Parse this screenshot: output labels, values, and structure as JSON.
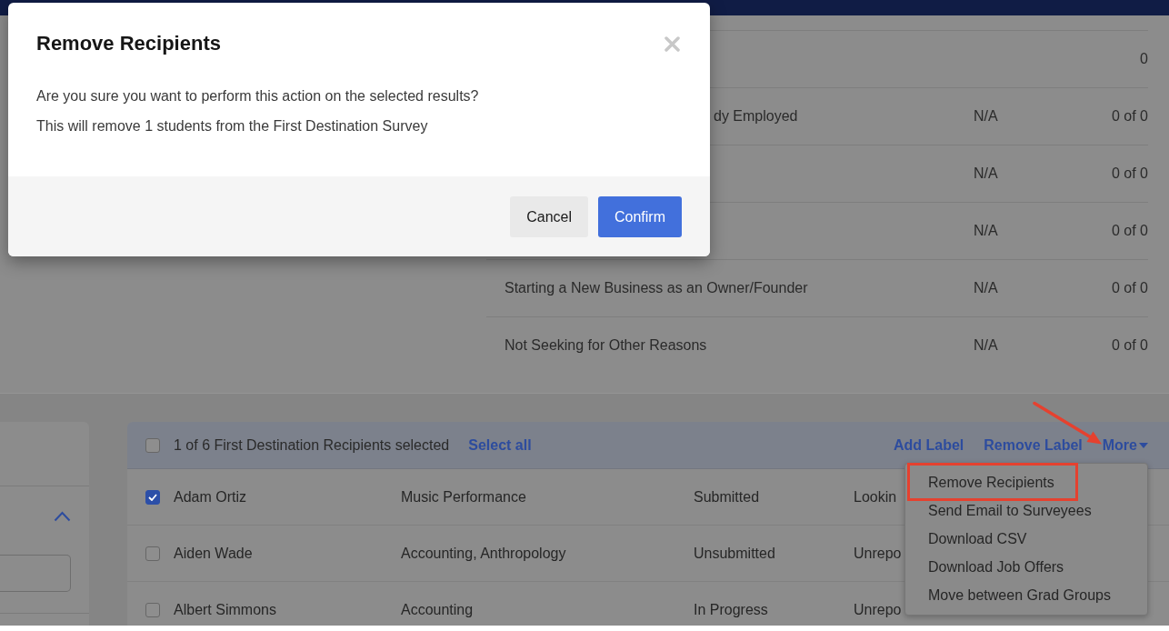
{
  "dialog": {
    "title": "Remove Recipients",
    "message": "Are you sure you want to perform this action on the selected results?",
    "detail": "This will remove 1 students from the First Destination Survey",
    "buttons": [
      {
        "label": "Cancel",
        "kind": "secondary"
      },
      {
        "label": "Confirm",
        "kind": "primary"
      }
    ]
  },
  "summary_table": {
    "rows": [
      {
        "column_3": "0"
      },
      {
        "column_1": "dy Employed",
        "column_2": "N/A",
        "column_3": "0 of 0"
      },
      {
        "column_2": "N/A",
        "column_3": "0 of 0"
      },
      {
        "column_2": "N/A",
        "column_3": "0 of 0"
      },
      {
        "column_1": "Starting a New Business as an Owner/Founder",
        "column_2": "N/A",
        "column_3": "0 of 0"
      },
      {
        "column_1": "Not Seeking for Other Reasons",
        "column_2": "N/A",
        "column_3": "0 of 0"
      }
    ]
  },
  "filter_panel": {
    "expanded": true
  },
  "recipients": {
    "header": {
      "checked": false,
      "summary": "1 of 6 First Destination Recipients selected",
      "link": "Select all"
    },
    "actions": [
      {
        "label": "Add Label",
        "kind": "link"
      },
      {
        "label": "Remove Label",
        "kind": "link"
      },
      {
        "label": "More",
        "kind": "dropdown"
      }
    ],
    "rows": [
      {
        "checked": true,
        "column_1": "Adam Ortiz",
        "column_2": "Music Performance",
        "column_3": "Submitted",
        "column_4": "Lookin"
      },
      {
        "checked": false,
        "column_1": "Aiden Wade",
        "column_2": "Accounting, Anthropology",
        "column_3": "Unsubmitted",
        "column_4": "Unrepo"
      },
      {
        "checked": false,
        "column_1": "Albert Simmons",
        "column_2": "Accounting",
        "column_3": "In Progress",
        "column_4": "Unrepo"
      }
    ]
  },
  "more_menu": {
    "items": [
      {
        "label": "Remove Recipients",
        "annotated": true
      },
      {
        "label": "Send Email to Surveyees",
        "annotated": false
      },
      {
        "label": "Download CSV",
        "annotated": false
      },
      {
        "label": "Download Job Offers",
        "annotated": false
      },
      {
        "label": "Move between Grad Groups",
        "annotated": false
      }
    ]
  },
  "annotations": [
    {
      "kind": "arrow"
    }
  ]
}
